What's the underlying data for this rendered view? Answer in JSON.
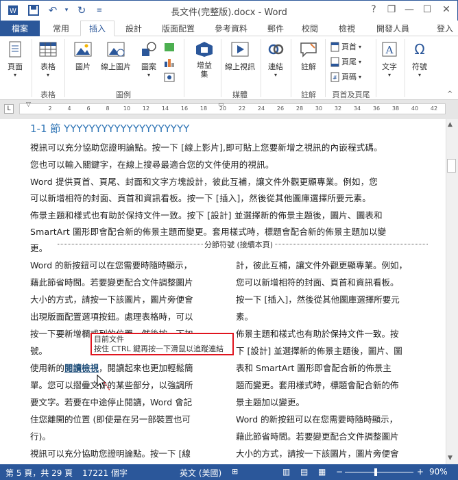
{
  "window": {
    "title": "長文件(完整版).docx - Word",
    "help": "?",
    "restore": "❐",
    "minimize": "—",
    "maximize": "☐",
    "close": "✕",
    "sign_in": "登入"
  },
  "tabs": [
    "檔案",
    "常用",
    "插入",
    "設計",
    "版面配置",
    "參考資料",
    "郵件",
    "校閱",
    "檢視",
    "開發人員"
  ],
  "ribbon": {
    "page": "頁面",
    "table": "表格",
    "picture": "圖片",
    "online_picture": "線上圖片",
    "shapes": "圖案",
    "addins": "增益\n集",
    "online_video": "線上視訊",
    "link": "連結",
    "comment": "註解",
    "header": "頁首",
    "footer": "頁尾",
    "page_number": "頁碼",
    "text": "文字",
    "symbol": "符號",
    "groups": {
      "table": "表格",
      "illustrations": "圖例",
      "media": "媒體",
      "comments": "註解",
      "header_footer": "頁首及頁尾"
    }
  },
  "ruler": {
    "h_ticks": [
      "2",
      "4",
      "6",
      "8",
      "10",
      "12",
      "14",
      "16",
      "18",
      "20",
      "22",
      "24",
      "26",
      "28",
      "30",
      "32",
      "34",
      "36",
      "38",
      "40",
      "42"
    ],
    "v_ticks": [
      "1",
      "2",
      "3",
      "4",
      "5",
      "6",
      "7",
      "8",
      "9",
      "10",
      "11",
      "12",
      "13",
      "14",
      "15",
      "16",
      "17",
      "18"
    ]
  },
  "doc": {
    "heading": "1-1 節 YYYYYYYYYYYYYYYYYYYY",
    "lines": [
      "視訊可以充分協助您證明論點。按一下 [線上影片],即可貼上您要新增之視訊的內嵌程式碼。",
      "您也可以輸入關鍵字，在線上搜尋最適合您的文件使用的視訊。",
      "Word 提供頁首、頁尾、封面和文字方塊設計，彼此互補，讓文件外觀更顯專業。例如，您",
      "可以新增相符的封面、頁首和資訊看板。按一下 [插入]，然後從其他圖庫選擇所要元素。",
      "佈景主題和樣式也有助於保持文件一致。按下 [設計] 並選擇新的佈景主題後，圖片、圖表和",
      "SmartArt 圖形即會配合新的佈景主題而變更。套用樣式時，標題會配合新的佈景主題加以變",
      "更。"
    ],
    "section_break": "分節符號 (接續本頁)",
    "left_col": [
      "Word 的新按鈕可以在您需要時隨時顯示，",
      "藉此節省時間。若要變更配合文件調整圖片",
      "大小的方式，請按一下該圖片，圖片旁便會",
      "出現版面配置選項按鈕。處理表格時，可以",
      "按一下要新增欄或列的位置，然後按一下加",
      "號。"
    ],
    "left_col_link_prefix": "使用新的",
    "left_col_link": "閱讀檢視",
    "left_col_link_suffix": "，閱讀起來也更加輕鬆簡",
    "left_col_rest": [
      "單。您可以摺疊文件的某些部分，以強調所",
      "要文字。若要在中途停止閱讀，Word 會記",
      "住您離開的位置 (即使是在另一部裝置也可",
      "行)。",
      "視訊可以充分協助您證明論點。按一下 [線"
    ],
    "right_col": [
      "計，彼此互補，讓文件外觀更顯專業。例如，",
      "您可以新增相符的封面、頁首和資訊看板。",
      "按一下 [插入]，然後從其他圖庫選擇所要元",
      "素。",
      "佈景主題和樣式也有助於保持文件一致。按",
      "下 [設計] 並選擇新的佈景主題後，圖片、圖",
      "表和 SmartArt 圖形即會配合新的佈景主",
      "題而變更。套用樣式時，標題會配合新的佈",
      "景主題加以變更。",
      "Word 的新按鈕可以在您需要時隨時顯示，",
      "藉此節省時間。若要變更配合文件調整圖片",
      "大小的方式，請按一下該圖片，圖片旁便會"
    ],
    "tooltip_line1": "目前文件",
    "tooltip_line2": "按住 CTRL 鍵再按一下滑鼠以追蹤連結"
  },
  "status": {
    "page": "第 5 頁，共 29 頁",
    "words": "17221 個字",
    "language": "英文 (美國)",
    "zoom": "90%",
    "zoom_minus": "−",
    "zoom_plus": "+"
  },
  "colors": {
    "accent": "#2b579a",
    "heading": "#2e74b5",
    "tooltip_border": "#e0141e"
  }
}
